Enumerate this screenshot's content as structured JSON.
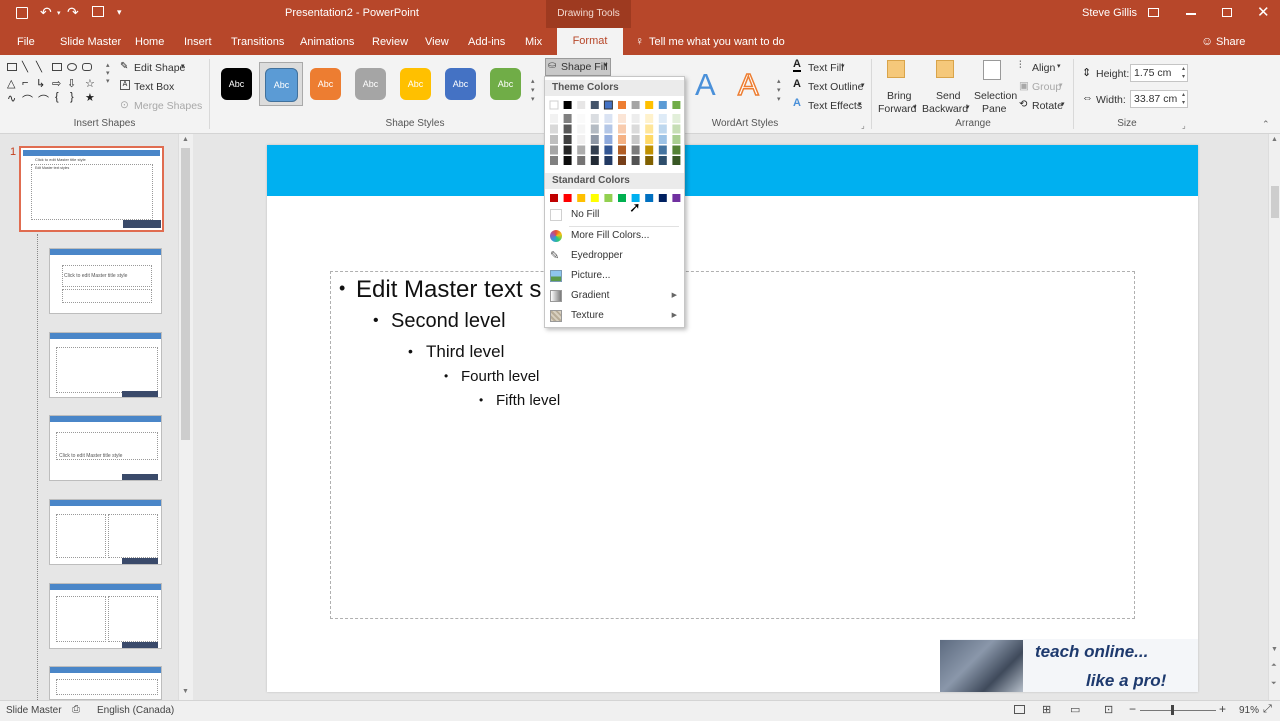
{
  "titlebar": {
    "title": "Presentation2 - PowerPoint",
    "contextual": "Drawing Tools",
    "user": "Steve Gillis"
  },
  "tabs": [
    "File",
    "Slide Master",
    "Home",
    "Insert",
    "Transitions",
    "Animations",
    "Review",
    "View",
    "Add-ins",
    "Mix"
  ],
  "active_tab": "Format",
  "tell_me": "Tell me what you want to do",
  "share": "Share",
  "ribbon": {
    "insert_shapes": {
      "edit_shape": "Edit Shape",
      "text_box": "Text Box",
      "merge_shapes": "Merge Shapes",
      "label": "Insert Shapes"
    },
    "shape_styles": {
      "sample": "Abc",
      "label": "Shape Styles",
      "colors": [
        "#000000",
        "#5b9bd5",
        "#ed7d31",
        "#a5a5a5",
        "#ffc000",
        "#4472c4",
        "#70ad47"
      ]
    },
    "shape_fill": "Shape Fill",
    "wordart": {
      "text_fill": "Text Fill",
      "text_outline": "Text Outline",
      "text_effects": "Text Effects",
      "label": "WordArt Styles",
      "sample": "A"
    },
    "arrange": {
      "bring_forward_1": "Bring",
      "bring_forward_2": "Forward",
      "send_backward_1": "Send",
      "send_backward_2": "Backward",
      "selection_pane_1": "Selection",
      "selection_pane_2": "Pane",
      "align": "Align",
      "group": "Group",
      "rotate": "Rotate",
      "label": "Arrange"
    },
    "size": {
      "height_label": "Height:",
      "height_value": "1.75 cm",
      "width_label": "Width:",
      "width_value": "33.87 cm",
      "label": "Size"
    }
  },
  "fill_menu": {
    "theme_colors_header": "Theme Colors",
    "standard_colors_header": "Standard Colors",
    "theme_top": [
      "#ffffff",
      "#000000",
      "#e7e6e6",
      "#44546a",
      "#4472c4",
      "#ed7d31",
      "#a5a5a5",
      "#ffc000",
      "#5b9bd5",
      "#70ad47"
    ],
    "standard": [
      "#c00000",
      "#ff0000",
      "#ffc000",
      "#ffff00",
      "#92d050",
      "#00b050",
      "#00b0f0",
      "#0070c0",
      "#002060",
      "#7030a0"
    ],
    "no_fill": "No Fill",
    "more_fill_colors": "More Fill Colors...",
    "eyedropper": "Eyedropper",
    "picture": "Picture...",
    "gradient": "Gradient",
    "texture": "Texture"
  },
  "thumbnails": {
    "first_number": "1",
    "t1_title": "Click to edit Master title style",
    "t1_bullets": "Edit Master text styles",
    "t2_text": "Click to edit Master title style",
    "t4_text": "Click to edit Master title style"
  },
  "slide": {
    "level1": "Edit Master text s",
    "level2": "Second level",
    "level3": "Third level",
    "level4": "Fourth level",
    "level5": "Fifth level",
    "logo_line1": "teach online...",
    "logo_line2": "like a pro!"
  },
  "status": {
    "view": "Slide Master",
    "language": "English (Canada)",
    "zoom": "91%"
  }
}
